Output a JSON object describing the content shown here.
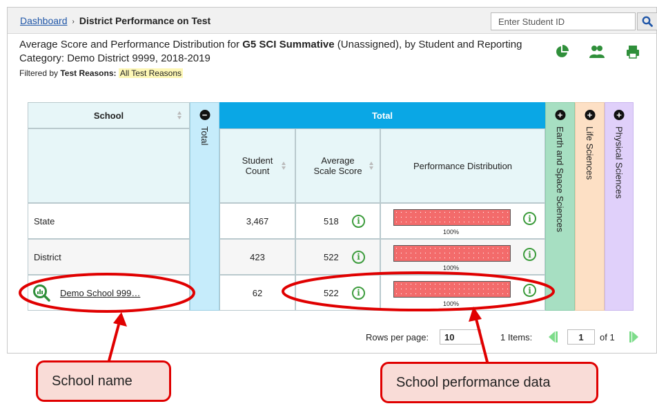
{
  "breadcrumb": {
    "home": "Dashboard",
    "separator": "›",
    "current": "District Performance on Test"
  },
  "search": {
    "placeholder": "Enter Student ID"
  },
  "title": {
    "prefix": "Average Score and Performance Distribution for ",
    "test": "G5 SCI Summative",
    "suffix": " (Unassigned), by Student and Reporting Category: Demo District 9999, 2018-2019"
  },
  "filter": {
    "label": "Filtered by ",
    "key": "Test Reasons:",
    "value": "All Test Reasons"
  },
  "table": {
    "school_header": "School",
    "total_collapsed": "Total",
    "total_header": "Total",
    "student_count": "Student Count",
    "avg_scale_score": "Average Scale Score",
    "perf_dist": "Performance Distribution",
    "categories": [
      "Earth and Space Sciences",
      "Life Sciences",
      "Physical Sciences"
    ],
    "rows": [
      {
        "name": "State",
        "count": "3,467",
        "score": "518",
        "bar": "100%",
        "fill": 1.0
      },
      {
        "name": "District",
        "count": "423",
        "score": "522",
        "bar": "100%",
        "fill": 1.0
      },
      {
        "name": "Demo School 999…",
        "count": "62",
        "score": "522",
        "bar": "100%",
        "fill": 1.0
      }
    ]
  },
  "pager": {
    "rows_label": "Rows per page:",
    "rows_value": "10",
    "items": "1 Items:",
    "page": "1",
    "of": "of 1"
  },
  "callouts": {
    "left": "School name",
    "right": "School performance data"
  },
  "colors": {
    "accent": "#0aa7e5",
    "annotation": "#e00000",
    "bar": "#f36b6b",
    "info": "#3b9b3b"
  }
}
